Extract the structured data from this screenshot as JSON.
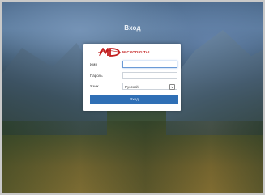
{
  "header": {
    "title": "Вход"
  },
  "logo": {
    "mark": "MD",
    "text": "MICRODIGITAL"
  },
  "form": {
    "username_label": "Имя",
    "username_value": "",
    "password_label": "Пароль",
    "password_value": "",
    "language_label": "Язык",
    "language_value": "Русский",
    "submit_label": "Вход"
  },
  "colors": {
    "brand_red": "#c21d1d",
    "button_blue": "#2f6fb5",
    "focus_border": "#6a9ad6"
  },
  "icons": {
    "select_arrow": "chevron-down-icon"
  }
}
